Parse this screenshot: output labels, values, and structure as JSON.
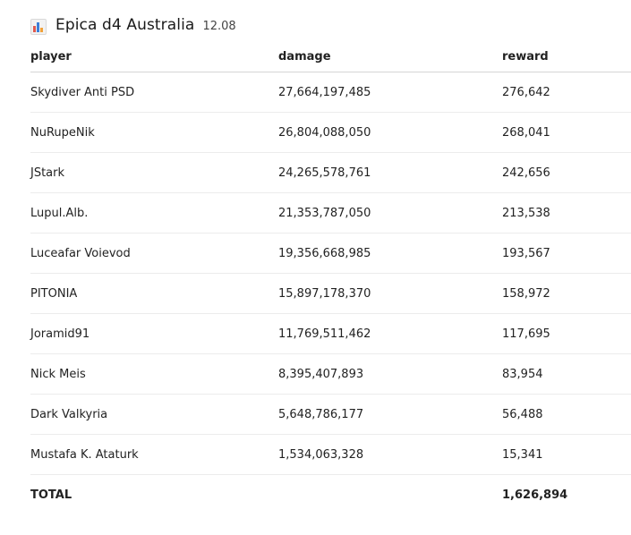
{
  "header": {
    "title": "Epica d4 Australia",
    "subtitle": "12.08",
    "icon": "bar-chart-icon"
  },
  "table": {
    "columns": [
      "player",
      "damage",
      "reward"
    ],
    "rows": [
      {
        "player": "Skydiver Anti PSD",
        "damage": "27,664,197,485",
        "reward": "276,642"
      },
      {
        "player": "NuRupeNik",
        "damage": "26,804,088,050",
        "reward": "268,041"
      },
      {
        "player": "JStark",
        "damage": "24,265,578,761",
        "reward": "242,656"
      },
      {
        "player": "Lupul.Alb.",
        "damage": "21,353,787,050",
        "reward": "213,538"
      },
      {
        "player": "Luceafar Voievod",
        "damage": "19,356,668,985",
        "reward": "193,567"
      },
      {
        "player": "PITONIA",
        "damage": "15,897,178,370",
        "reward": "158,972"
      },
      {
        "player": "Joramid91",
        "damage": "11,769,511,462",
        "reward": "117,695"
      },
      {
        "player": "Nick Meis",
        "damage": "8,395,407,893",
        "reward": "83,954"
      },
      {
        "player": "Dark Valkyria",
        "damage": "5,648,786,177",
        "reward": "56,488"
      },
      {
        "player": "Mustafa K. Ataturk",
        "damage": "1,534,063,328",
        "reward": "15,341"
      }
    ],
    "total": {
      "label": "TOTAL",
      "damage": "",
      "reward": "1,626,894"
    }
  }
}
